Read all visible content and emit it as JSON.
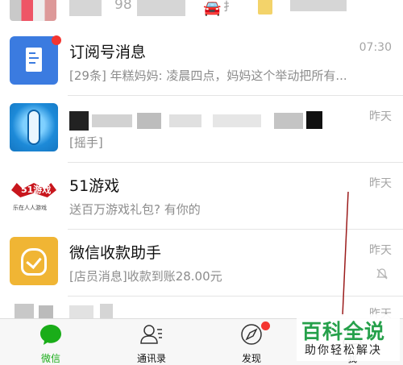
{
  "top_row": {
    "partial_number": "98"
  },
  "chats": [
    {
      "id": "subscriptions",
      "title": "订阅号消息",
      "preview": "[29条] 年糕妈妈: 凌晨四点，妈妈这个举动把所有...",
      "time": "07:30",
      "unread_dot": true
    },
    {
      "id": "remote-app",
      "title": "",
      "preview": "[摇手]",
      "time": "昨天"
    },
    {
      "id": "51game",
      "title": "51游戏",
      "preview": "送百万游戏礼包? 有你的",
      "time": "昨天",
      "avatar_text": "51游戏",
      "avatar_small": "乐在人人游戏"
    },
    {
      "id": "wechat-pay",
      "title": "微信收款助手",
      "preview": "[店员消息]收款到账28.00元",
      "time": "昨天",
      "muted": true
    },
    {
      "id": "partial",
      "title": "",
      "preview": "",
      "time": "昨天"
    }
  ],
  "tabbar": {
    "tabs": [
      {
        "label": "微信",
        "active": true,
        "icon": "chat-bubble-icon"
      },
      {
        "label": "通讯录",
        "active": false,
        "icon": "contacts-icon"
      },
      {
        "label": "发现",
        "active": false,
        "icon": "compass-icon",
        "badge": true
      },
      {
        "label": "我",
        "active": false,
        "icon": "person-icon"
      }
    ]
  },
  "watermark": {
    "main": "百科全说",
    "sub": "助你轻松解决"
  },
  "colors": {
    "wechat_green": "#1aad19",
    "badge_red": "#f43530",
    "watermark_green": "#25a04a"
  }
}
